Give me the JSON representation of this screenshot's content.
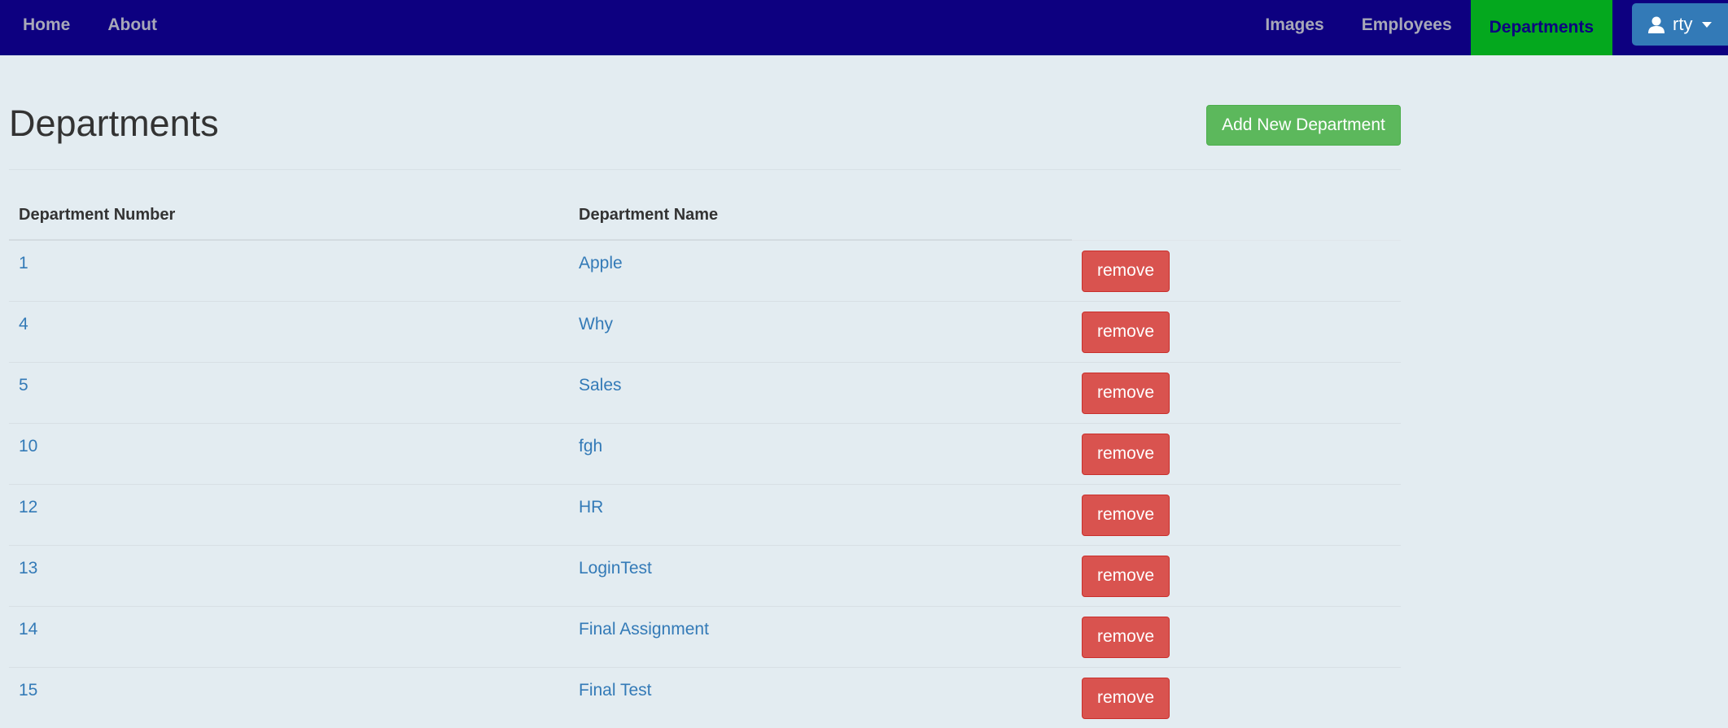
{
  "nav": {
    "left": [
      "Home",
      "About"
    ],
    "right": [
      "Images",
      "Employees",
      "Departments"
    ],
    "active": "Departments",
    "user": "rty"
  },
  "page": {
    "title": "Departments",
    "add_button": "Add New Department"
  },
  "table": {
    "headers": [
      "Department Number",
      "Department Name",
      ""
    ],
    "remove_label": "remove",
    "rows": [
      {
        "number": "1",
        "name": "Apple"
      },
      {
        "number": "4",
        "name": "Why"
      },
      {
        "number": "5",
        "name": "Sales"
      },
      {
        "number": "10",
        "name": "fgh"
      },
      {
        "number": "12",
        "name": "HR"
      },
      {
        "number": "13",
        "name": "LoginTest"
      },
      {
        "number": "14",
        "name": "Final Assignment"
      },
      {
        "number": "15",
        "name": "Final Test"
      }
    ]
  },
  "colors": {
    "navbar": "#0d0080",
    "active_tab": "#04a81e",
    "success": "#5cb85c",
    "danger": "#d9534f",
    "link": "#337ab7",
    "background": "#e3ecf1"
  },
  "icons": {
    "user": "user-icon",
    "dropdown": "caret-down-icon"
  }
}
